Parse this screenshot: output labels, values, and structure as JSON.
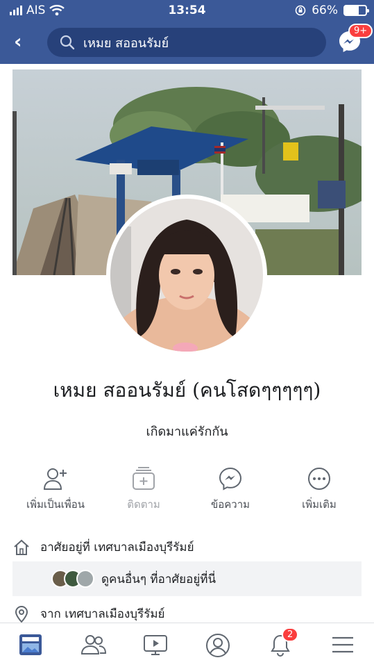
{
  "status_bar": {
    "carrier": "AIS",
    "time": "13:54",
    "battery": "66%",
    "battery_level": 0.66
  },
  "search": {
    "query": "เหมย สออนรัมย์"
  },
  "messenger": {
    "badge": "9+"
  },
  "profile": {
    "name": "เหมย สออนรัมย์ (คนโสดๆๆๆๆๆ)",
    "bio": "เกิดมาแค่รักกัน"
  },
  "actions": [
    {
      "label": "เพิ่มเป็นเพื่อน"
    },
    {
      "label": "ติดตาม"
    },
    {
      "label": "ข้อความ"
    },
    {
      "label": "เพิ่มเติม"
    }
  ],
  "info": {
    "lives_in": "อาศัยอยู่ที่ เทศบาลเมืองบุรีรัมย์",
    "friends_nearby": "ดูคนอื่นๆ ที่อาศัยอยู่ที่นี่",
    "from": "จาก เทศบาลเมืองบุรีรัมย์"
  },
  "tabbar": {
    "notifications_badge": "2"
  },
  "colors": {
    "brand": "#3b5998",
    "badge": "#fa3e3e"
  }
}
